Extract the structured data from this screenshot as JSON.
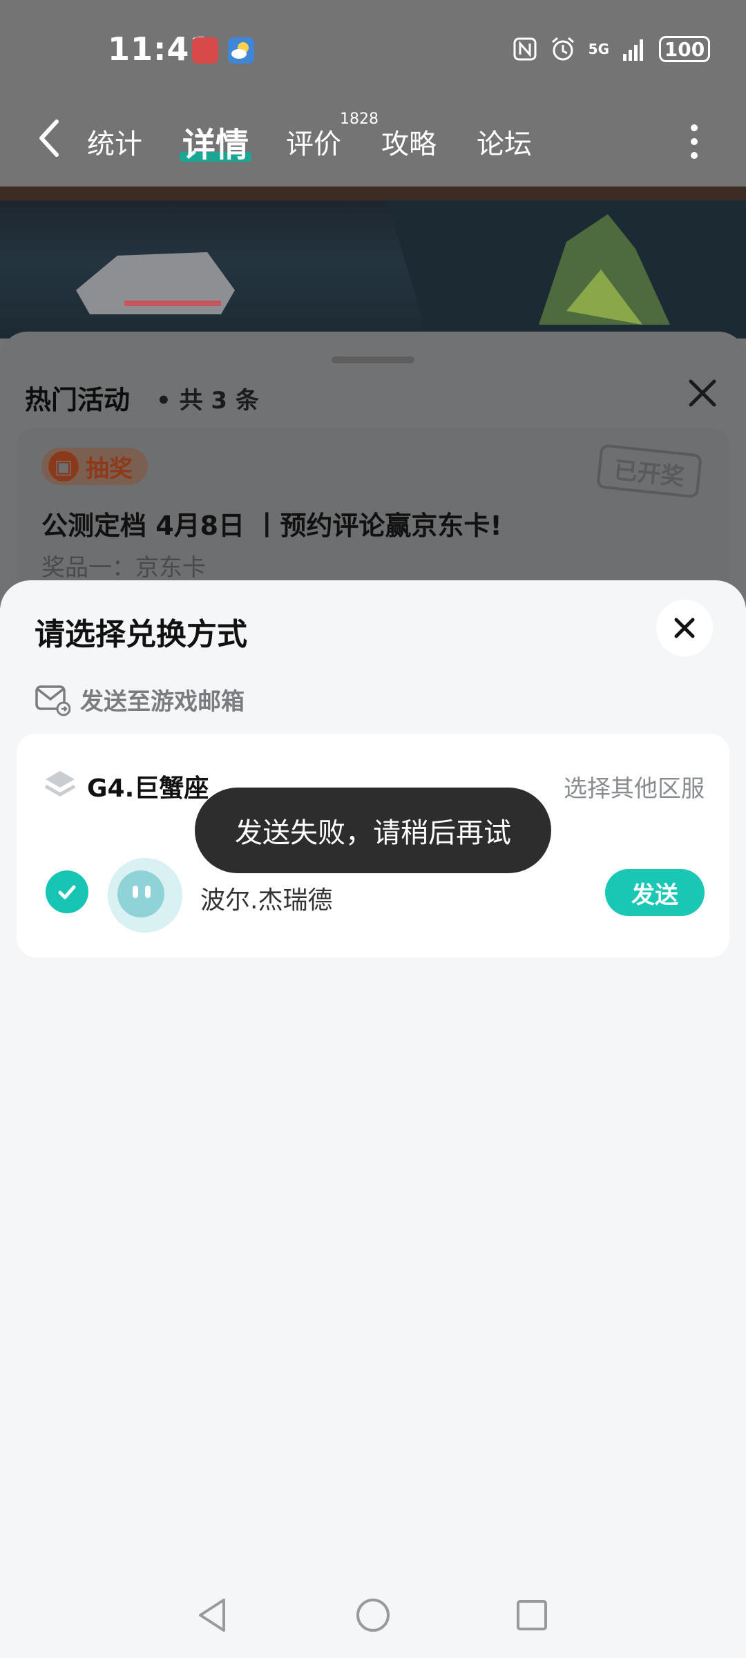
{
  "status": {
    "time": "11:41",
    "network": "5G",
    "battery": "100"
  },
  "nav": {
    "tabs": [
      {
        "label": "统计"
      },
      {
        "label": "详情"
      },
      {
        "label": "评价",
        "badge": "1828"
      },
      {
        "label": "攻略"
      },
      {
        "label": "论坛"
      }
    ],
    "active_tab": "详情"
  },
  "activities": {
    "title": "热门活动",
    "count": "• 共 3 条",
    "card": {
      "tag": "抽奖",
      "stamp": "已开奖",
      "title": "公测定档 4月8日 丨预约评论赢京东卡!",
      "prize": "奖品一：京东卡"
    }
  },
  "dialog": {
    "title": "请选择兑换方式",
    "mail_label": "发送至游戏邮箱",
    "server": "G4.巨蟹座",
    "switch_server": "选择其他区服",
    "player": "波尔.杰瑞德",
    "send_label": "发送"
  },
  "toast": "发送失败，请稍后再试",
  "colors": {
    "accent": "#1ac7b5",
    "tab_underline": "#1aa694",
    "toast_bg": "#2d2d2d"
  }
}
